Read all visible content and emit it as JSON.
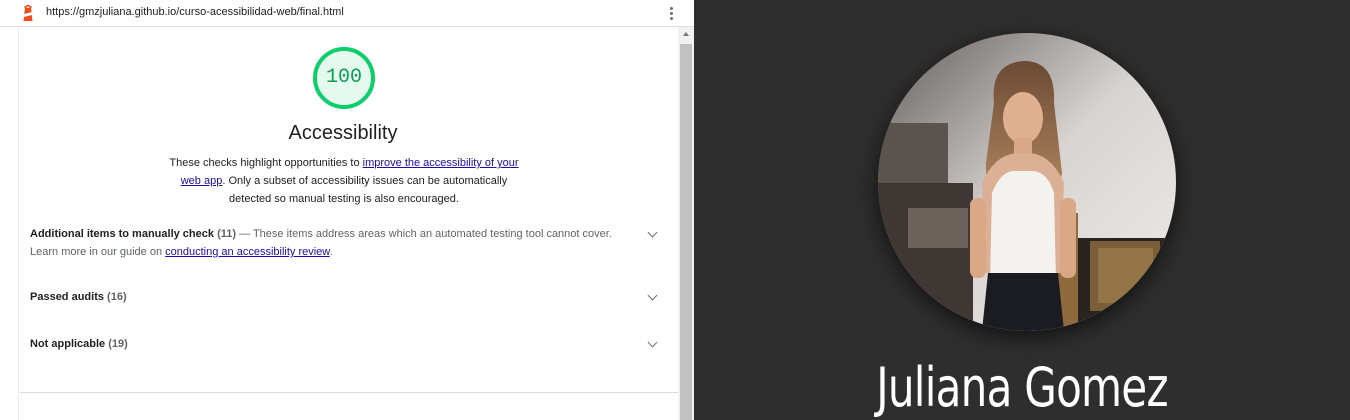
{
  "url_bar": {
    "url": "https://gmzjuliana.github.io/curso-acessibilidad-web/final.html"
  },
  "report": {
    "score": "100",
    "score_fraction": 1.0,
    "score_color": "#0cce6b",
    "category_title": "Accessibility",
    "description": {
      "text_before": "These checks highlight opportunities to ",
      "link": "improve the accessibility of your web app",
      "text_after": ". Only a subset of accessibility issues can be automatically detected so manual testing is also encouraged."
    },
    "groups": [
      {
        "title": "Additional items to manually check",
        "count": "(11)",
        "desc_before": " — These items address areas which an automated testing tool cannot cover. Learn more in our guide on ",
        "link": "conducting an accessibility review",
        "desc_after": "."
      },
      {
        "title": "Passed audits",
        "count": "(16)"
      },
      {
        "title": "Not applicable",
        "count": "(19)"
      }
    ]
  },
  "profile": {
    "name": "Juliana Gomez"
  },
  "colors": {
    "pass_green": "#0cce6b",
    "link_blue": "#1a0dab",
    "profile_background": "#2e2e2e"
  },
  "icons": [
    "lighthouse-icon",
    "kebab-menu-icon",
    "chevron-down-icon",
    "scroll-up-arrow-icon"
  ]
}
